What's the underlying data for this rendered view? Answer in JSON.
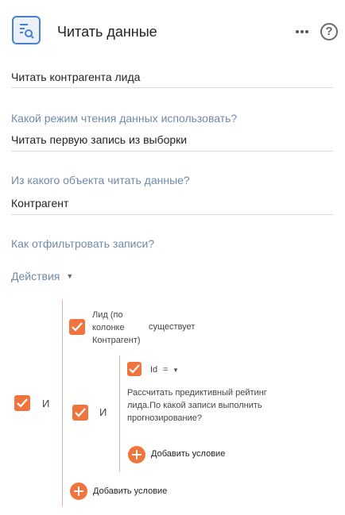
{
  "header": {
    "title": "Читать данные",
    "icon": "read-data-icon",
    "more_icon": "more-icon",
    "help_icon": "help-icon",
    "help_symbol": "?"
  },
  "element_name": "Читать контрагента лида",
  "read_mode": {
    "label": "Какой режим чтения данных использовать?",
    "value": "Читать первую запись из выборки"
  },
  "object": {
    "label": "Из какого объекта читать данные?",
    "value": "Контрагент"
  },
  "filter": {
    "label": "Как отфильтровать записи?",
    "actions_label": "Действия",
    "outer_group_operator": "И",
    "condition1": {
      "column": "Лид (по колонке Контрагент)",
      "column_line1": "Лид (по",
      "column_line2": "колонке",
      "column_line3": "Контрагент)",
      "comparison": "существует"
    },
    "inner_group": {
      "operator": "И",
      "condition": {
        "column": "Id",
        "comparison": "=",
        "value_line1": "Рассчитать предиктивный рейтинг",
        "value_line2": "лида.По какой записи выполнить",
        "value_line3": "прогнозирование?"
      },
      "add_condition_label": "Добавить условие"
    },
    "add_condition_label": "Добавить условие"
  },
  "colors": {
    "accent": "#f0743e",
    "label": "#6f8aa8",
    "icon_blue": "#4a7fd1"
  }
}
